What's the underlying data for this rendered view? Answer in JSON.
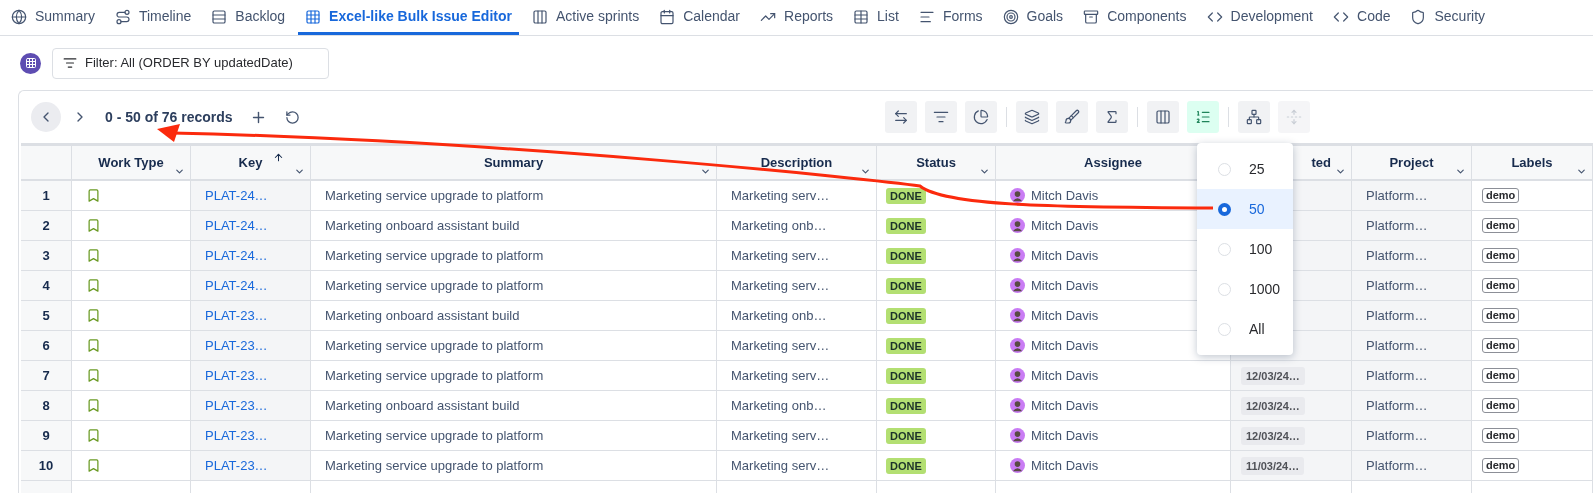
{
  "tabs": [
    {
      "label": "Summary",
      "selected": false
    },
    {
      "label": "Timeline",
      "selected": false
    },
    {
      "label": "Backlog",
      "selected": false
    },
    {
      "label": "Excel-like Bulk Issue Editor",
      "selected": true
    },
    {
      "label": "Active sprints",
      "selected": false
    },
    {
      "label": "Calendar",
      "selected": false
    },
    {
      "label": "Reports",
      "selected": false
    },
    {
      "label": "List",
      "selected": false
    },
    {
      "label": "Forms",
      "selected": false
    },
    {
      "label": "Goals",
      "selected": false
    },
    {
      "label": "Components",
      "selected": false
    },
    {
      "label": "Development",
      "selected": false
    },
    {
      "label": "Code",
      "selected": false
    },
    {
      "label": "Security",
      "selected": false
    }
  ],
  "filter": {
    "label": "Filter: All (ORDER BY updatedDate)"
  },
  "pager": {
    "range": "0 - 50 of 76 records"
  },
  "toolbar": [
    {
      "active": false,
      "disabled": false
    },
    {
      "active": false,
      "disabled": false
    },
    {
      "active": false,
      "disabled": false
    },
    {
      "active": false,
      "disabled": false
    },
    {
      "active": false,
      "disabled": false
    },
    {
      "active": false,
      "disabled": false
    },
    {
      "active": false,
      "disabled": false
    },
    {
      "active": true,
      "disabled": false
    },
    {
      "active": false,
      "disabled": false
    },
    {
      "active": false,
      "disabled": true
    }
  ],
  "columns": [
    {
      "label": "Work Type",
      "sorted": false
    },
    {
      "label": "Key",
      "sorted": true
    },
    {
      "label": "Summary",
      "sorted": false
    },
    {
      "label": "Description",
      "sorted": false
    },
    {
      "label": "Status",
      "sorted": false
    },
    {
      "label": "Assignee",
      "sorted": false
    },
    {
      "label": "ted",
      "sorted": false
    },
    {
      "label": "Project",
      "sorted": false
    },
    {
      "label": "Labels",
      "sorted": false
    }
  ],
  "rows": [
    {
      "num": "1",
      "key": "PLAT-24…",
      "summary": "Marketing service upgrade to platform",
      "description": "Marketing serv…",
      "status": "DONE",
      "assignee": "Mitch Davis",
      "project": "Platform…",
      "label": "demo"
    },
    {
      "num": "2",
      "key": "PLAT-24…",
      "summary": "Marketing onboard assistant build",
      "description": "Marketing onb…",
      "status": "DONE",
      "assignee": "Mitch Davis",
      "project": "Platform…",
      "label": "demo"
    },
    {
      "num": "3",
      "key": "PLAT-24…",
      "summary": "Marketing service upgrade to platform",
      "description": "Marketing serv…",
      "status": "DONE",
      "assignee": "Mitch Davis",
      "project": "Platform…",
      "label": "demo"
    },
    {
      "num": "4",
      "key": "PLAT-24…",
      "summary": "Marketing service upgrade to platform",
      "description": "Marketing serv…",
      "status": "DONE",
      "assignee": "Mitch Davis",
      "project": "Platform…",
      "label": "demo"
    },
    {
      "num": "5",
      "key": "PLAT-23…",
      "summary": "Marketing onboard assistant build",
      "description": "Marketing onb…",
      "status": "DONE",
      "assignee": "Mitch Davis",
      "project": "Platform…",
      "label": "demo"
    },
    {
      "num": "6",
      "key": "PLAT-23…",
      "summary": "Marketing service upgrade to platform",
      "description": "Marketing serv…",
      "status": "DONE",
      "assignee": "Mitch Davis",
      "project": "Platform…",
      "label": "demo"
    },
    {
      "num": "7",
      "key": "PLAT-23…",
      "summary": "Marketing service upgrade to platform",
      "description": "Marketing serv…",
      "status": "DONE",
      "assignee": "Mitch Davis",
      "updated": "12/03/24…",
      "project": "Platform…",
      "label": "demo"
    },
    {
      "num": "8",
      "key": "PLAT-23…",
      "summary": "Marketing onboard assistant build",
      "description": "Marketing onb…",
      "status": "DONE",
      "assignee": "Mitch Davis",
      "updated": "12/03/24…",
      "project": "Platform…",
      "label": "demo"
    },
    {
      "num": "9",
      "key": "PLAT-23…",
      "summary": "Marketing service upgrade to platform",
      "description": "Marketing serv…",
      "status": "DONE",
      "assignee": "Mitch Davis",
      "updated": "12/03/24…",
      "project": "Platform…",
      "label": "demo"
    },
    {
      "num": "10",
      "key": "PLAT-23…",
      "summary": "Marketing service upgrade to platform",
      "description": "Marketing serv…",
      "status": "DONE",
      "assignee": "Mitch Davis",
      "updated": "11/03/24…",
      "project": "Platform…",
      "label": "demo"
    }
  ],
  "page_size_menu": {
    "options": [
      {
        "label": "25",
        "selected": false
      },
      {
        "label": "50",
        "selected": true
      },
      {
        "label": "100",
        "selected": false
      },
      {
        "label": "1000",
        "selected": false
      },
      {
        "label": "All",
        "selected": false
      }
    ]
  }
}
